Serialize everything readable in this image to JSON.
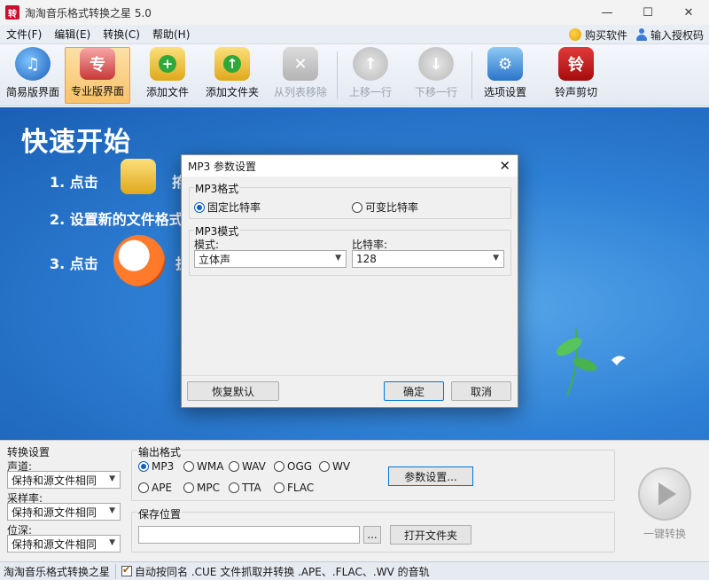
{
  "window": {
    "title": "淘淘音乐格式转换之星 5.0",
    "app_icon_glyph": "转",
    "controls": {
      "minimize": "—",
      "maximize": "☐",
      "close": "✕"
    }
  },
  "menu": {
    "items": [
      "文件(F)",
      "编辑(E)",
      "转换(C)",
      "帮助(H)"
    ],
    "right": {
      "buy": "购买软件",
      "register": "输入授权码"
    }
  },
  "toolbar": {
    "buttons": [
      {
        "label": "简易版界面",
        "icon": "easy-mode-icon"
      },
      {
        "label": "专业版界面",
        "icon": "pro-mode-icon",
        "glyph": "专"
      },
      {
        "label": "添加文件",
        "icon": "add-file-icon"
      },
      {
        "label": "添加文件夹",
        "icon": "add-folder-icon"
      },
      {
        "label": "从列表移除",
        "icon": "remove-icon"
      },
      {
        "label": "上移一行",
        "icon": "move-up-icon"
      },
      {
        "label": "下移一行",
        "icon": "move-down-icon"
      },
      {
        "label": "选项设置",
        "icon": "options-icon"
      },
      {
        "label": "铃声剪切",
        "icon": "ringtone-icon",
        "glyph": "铃"
      }
    ]
  },
  "quickstart": {
    "title": "快速开始",
    "step1": "1. 点击",
    "step1_tail": "拵",
    "step2": "2. 设置新的文件格式",
    "step3": "3. 点击",
    "step3_tail": "抈"
  },
  "dialog": {
    "title": "MP3 参数设置",
    "format_group": "MP3格式",
    "cbr": "固定比特率",
    "vbr": "可变比特率",
    "mode_group": "MP3模式",
    "mode_label": "模式:",
    "mode_value": "立体声",
    "bitrate_label": "比特率:",
    "bitrate_value": "128",
    "reset": "恢复默认",
    "ok": "确定",
    "cancel": "取消"
  },
  "settings": {
    "title": "转换设置",
    "channel_label": "声道:",
    "channel_value": "保持和源文件相同",
    "samplerate_label": "采样率:",
    "samplerate_value": "保持和源文件相同",
    "bitdepth_label": "位深:",
    "bitdepth_value": "保持和源文件相同"
  },
  "output": {
    "title": "输出格式",
    "formats_row1": [
      "MP3",
      "WMA",
      "WAV",
      "OGG",
      "WV"
    ],
    "formats_row2": [
      "APE",
      "MPC",
      "TTA",
      "FLAC"
    ],
    "selected": "MP3",
    "params_button": "参数设置...",
    "save_title": "保存位置",
    "save_path": "",
    "browse": "...",
    "open_folder": "打开文件夹"
  },
  "convert": {
    "label": "一键转换"
  },
  "status": {
    "app_name": "淘淘音乐格式转换之星",
    "auto_rename": "自动按同名 .CUE 文件抓取并转换 .APE、.FLAC、.WV 的音轨"
  },
  "colors": {
    "accent": "#0a60c0",
    "main_bg": "#2e80d6"
  }
}
